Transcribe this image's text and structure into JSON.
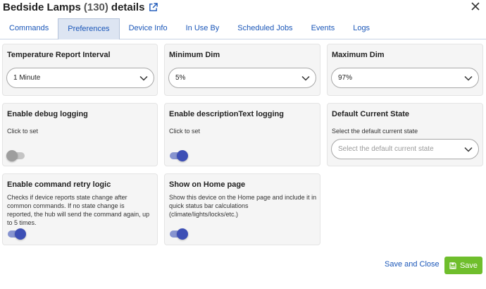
{
  "header": {
    "device_name": "Bedside Lamps",
    "device_count": "(130)",
    "suffix": "details",
    "external_link_icon": "external-link-icon",
    "close_icon": "close-icon"
  },
  "tabs": [
    {
      "label": "Commands",
      "active": false
    },
    {
      "label": "Preferences",
      "active": true
    },
    {
      "label": "Device Info",
      "active": false
    },
    {
      "label": "In Use By",
      "active": false
    },
    {
      "label": "Scheduled Jobs",
      "active": false
    },
    {
      "label": "Events",
      "active": false
    },
    {
      "label": "Logs",
      "active": false
    }
  ],
  "preferences": {
    "temp_interval": {
      "title": "Temperature Report Interval",
      "value": "1 Minute"
    },
    "min_dim": {
      "title": "Minimum Dim",
      "value": "5%"
    },
    "max_dim": {
      "title": "Maximum Dim",
      "value": "97%"
    },
    "debug_logging": {
      "title": "Enable debug logging",
      "desc": "Click to set",
      "enabled": false
    },
    "desc_text_logging": {
      "title": "Enable descriptionText logging",
      "desc": "Click to set",
      "enabled": true
    },
    "default_state": {
      "title": "Default Current State",
      "desc": "Select the default current state",
      "placeholder": "Select the default current state"
    },
    "retry_logic": {
      "title": "Enable command retry logic",
      "desc": "Checks if device reports state change after common commands. If no state change is reported, the hub will send the command again, up to 5 times.",
      "enabled": true
    },
    "show_home": {
      "title": "Show on Home page",
      "desc": "Show this device on the Home page and include it in quick status bar calculations (climate/lights/locks/etc.)",
      "enabled": true
    }
  },
  "footer": {
    "save_close_label": "Save and Close",
    "save_label": "Save",
    "save_icon": "floppy-disk-icon"
  },
  "colors": {
    "accent": "#1a56b8",
    "toggle_on": "#3d4fb5",
    "save_button": "#6fbe2c"
  }
}
